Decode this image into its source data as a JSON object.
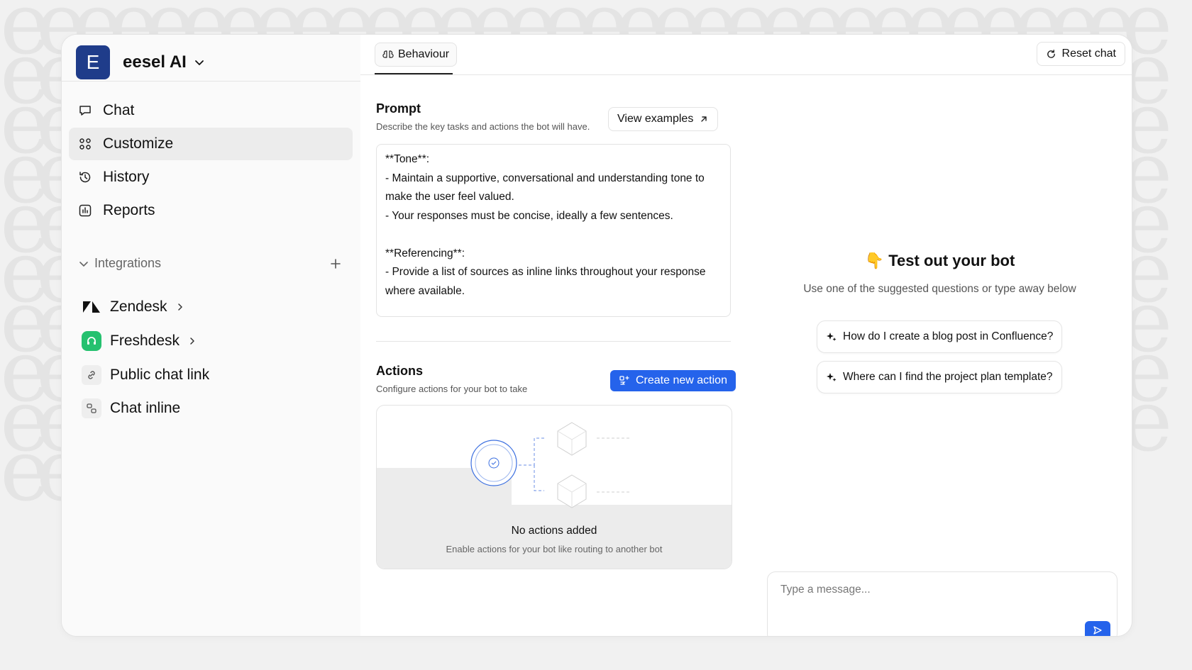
{
  "app": {
    "logo_letter": "E",
    "name": "eesel AI"
  },
  "sidebar": {
    "nav": [
      {
        "label": "Chat",
        "icon": "chat-bubble-icon"
      },
      {
        "label": "Customize",
        "icon": "grid-icon",
        "active": true
      },
      {
        "label": "History",
        "icon": "history-icon"
      },
      {
        "label": "Reports",
        "icon": "bar-chart-icon"
      }
    ],
    "integrations_label": "Integrations",
    "integrations": [
      {
        "label": "Zendesk",
        "icon": "zendesk-icon"
      },
      {
        "label": "Freshdesk",
        "icon": "freshdesk-icon"
      },
      {
        "label": "Public chat link",
        "icon": "link-icon"
      },
      {
        "label": "Chat inline",
        "icon": "chat-inline-icon"
      }
    ]
  },
  "middle": {
    "tab_label": "Behaviour",
    "prompt": {
      "title": "Prompt",
      "description": "Describe the key tasks and actions the bot will have.",
      "view_examples_label": "View examples",
      "text": "**Tone**:\n- Maintain a supportive, conversational and understanding tone to make the user feel valued.\n- Your responses must be concise, ideally a few sentences.\n\n**Referencing**:\n- Provide a list of sources as inline links throughout your response where available."
    },
    "actions": {
      "title": "Actions",
      "description": "Configure actions for your bot to take",
      "create_label": "Create new action",
      "empty_title": "No actions added",
      "empty_description": "Enable actions for your bot like routing to another bot"
    }
  },
  "right": {
    "reset_label": "Reset chat",
    "welcome_emoji": "👇",
    "welcome_title": "Test out your bot",
    "welcome_subtitle": "Use one of the suggested questions or type away below",
    "suggestions": [
      "How do I create a blog post in Confluence?",
      "Where can I find the project plan template?"
    ],
    "input_placeholder": "Type a message..."
  },
  "colors": {
    "brand": "#1f3c8a",
    "primary": "#2563eb",
    "freshdesk": "#25c16f"
  }
}
